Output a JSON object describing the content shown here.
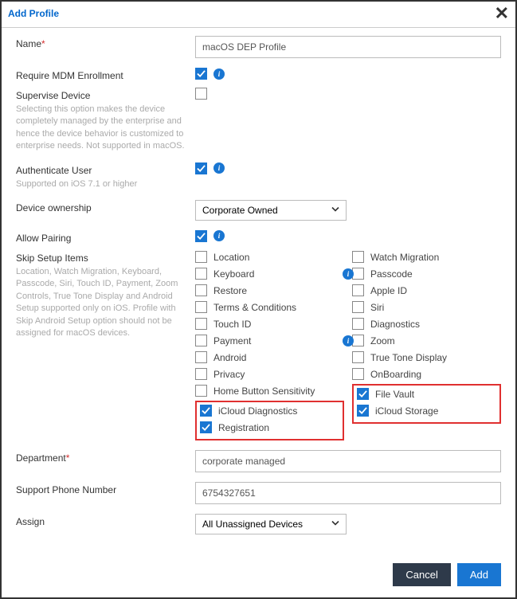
{
  "header": {
    "title": "Add Profile"
  },
  "fields": {
    "name": {
      "label": "Name",
      "value": "macOS DEP Profile"
    },
    "require_mdm": {
      "label": "Require MDM Enrollment",
      "checked": true
    },
    "supervise": {
      "label": "Supervise Device",
      "helper": "Selecting this option makes the device completely managed by the enterprise and hence the device behavior is customized to enterprise needs. Not supported in macOS.",
      "checked": false
    },
    "auth_user": {
      "label": "Authenticate User",
      "helper": "Supported on iOS 7.1 or higher",
      "checked": true
    },
    "device_ownership": {
      "label": "Device ownership",
      "value": "Corporate Owned"
    },
    "allow_pairing": {
      "label": "Allow Pairing",
      "checked": true
    },
    "skip": {
      "label": "Skip Setup Items",
      "helper": "Location, Watch Migration, Keyboard, Passcode, Siri, Touch ID, Payment, Zoom Controls, True Tone Display and Android Setup supported only on iOS. Profile with Skip Android Setup option should not be assigned for macOS devices.",
      "left": [
        {
          "label": "Location",
          "checked": false,
          "info": false
        },
        {
          "label": "Keyboard",
          "checked": false,
          "info": false
        },
        {
          "label": "Restore",
          "checked": false,
          "info": false
        },
        {
          "label": "Terms & Conditions",
          "checked": false,
          "info": false
        },
        {
          "label": "Touch ID",
          "checked": false,
          "info": false
        },
        {
          "label": "Payment",
          "checked": false,
          "info": false
        },
        {
          "label": "Android",
          "checked": false,
          "info": false
        },
        {
          "label": "Privacy",
          "checked": false,
          "info": false
        },
        {
          "label": "Home Button Sensitivity",
          "checked": false,
          "info": false
        }
      ],
      "left_highlight": [
        {
          "label": "iCloud Diagnostics",
          "checked": true
        },
        {
          "label": "Registration",
          "checked": true
        }
      ],
      "right": [
        {
          "label": "Watch Migration",
          "checked": false,
          "info": false
        },
        {
          "label": "Passcode",
          "checked": false,
          "info": true
        },
        {
          "label": "Apple ID",
          "checked": false,
          "info": false
        },
        {
          "label": "Siri",
          "checked": false,
          "info": false
        },
        {
          "label": "Diagnostics",
          "checked": false,
          "info": false
        },
        {
          "label": "Zoom",
          "checked": false,
          "info": true
        },
        {
          "label": "True Tone Display",
          "checked": false,
          "info": false
        },
        {
          "label": "OnBoarding",
          "checked": false,
          "info": false
        }
      ],
      "right_highlight": [
        {
          "label": "File Vault",
          "checked": true
        },
        {
          "label": "iCloud Storage",
          "checked": true
        }
      ]
    },
    "department": {
      "label": "Department",
      "value": "corporate managed"
    },
    "support_phone": {
      "label": "Support Phone Number",
      "value": "6754327651"
    },
    "assign": {
      "label": "Assign",
      "value": "All Unassigned Devices"
    }
  },
  "buttons": {
    "cancel": "Cancel",
    "add": "Add"
  }
}
